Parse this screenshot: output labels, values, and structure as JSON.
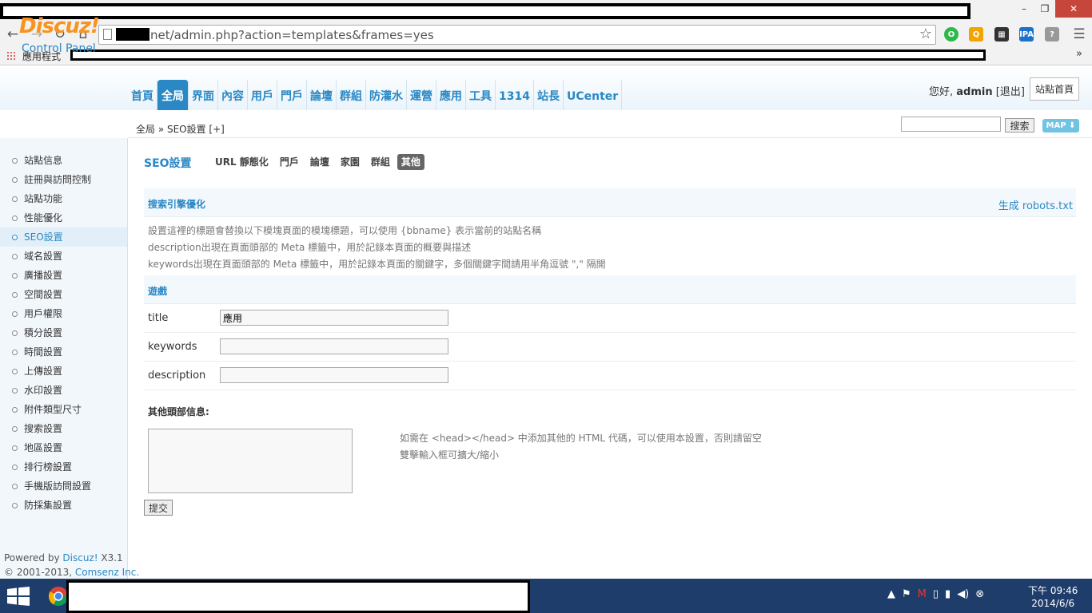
{
  "browser": {
    "url_visible": "net/admin.php?action=templates&frames=yes",
    "apps_label": "應用程式",
    "win_min": "–",
    "win_max": "❐",
    "win_close": "✕"
  },
  "header": {
    "logo": "Discuz!",
    "logo_sub": "Control Panel",
    "nav": [
      "首頁",
      "全局",
      "界面",
      "內容",
      "用戶",
      "門戶",
      "論壇",
      "群組",
      "防灌水",
      "運營",
      "應用",
      "工具",
      "1314",
      "站長",
      "UCenter"
    ],
    "active_nav": "全局",
    "greeting_prefix": "您好,",
    "user": "admin",
    "logout": "[退出]",
    "site_home": "站點首頁"
  },
  "subbar": {
    "breadcrumb": "全局 » SEO設置  [+]",
    "search_btn": "搜索",
    "map_btn": "MAP ⬇"
  },
  "sidebar": {
    "items": [
      "站點信息",
      "註冊與訪問控制",
      "站點功能",
      "性能優化",
      "SEO設置",
      "域名設置",
      "廣播設置",
      "空間設置",
      "用戶權限",
      "積分設置",
      "時間設置",
      "上傳設置",
      "水印設置",
      "附件類型尺寸",
      "搜索設置",
      "地區設置",
      "排行榜設置",
      "手機版訪問設置",
      "防採集設置"
    ],
    "active": "SEO設置",
    "powered_line1": "Powered by",
    "powered_brand": "Discuz!",
    "powered_ver": " X3.1",
    "copyright": "© 2001-2013, ",
    "company": "Comsenz Inc."
  },
  "content": {
    "title": "SEO設置",
    "tabs": [
      "URL 靜態化",
      "門戶",
      "論壇",
      "家園",
      "群組",
      "其他"
    ],
    "active_tab": "其他",
    "section1_title": "搜索引擎優化",
    "robots_link": "生成 robots.txt",
    "tips": [
      "設置這裡的標題會替換以下模塊頁面的模塊標題，可以使用 {bbname} 表示當前的站點名稱",
      "description出現在頁面頭部的 Meta 標籤中，用於記錄本頁面的概要與描述",
      "keywords出現在頁面頭部的 Meta 標籤中，用於記錄本頁面的關鍵字，多個關鍵字間請用半角逗號 \",\" 隔開"
    ],
    "section2_title": "遊戲",
    "fields": [
      {
        "label": "title",
        "value": "應用"
      },
      {
        "label": "keywords",
        "value": ""
      },
      {
        "label": "description",
        "value": ""
      }
    ],
    "extra_label": "其他頭部信息:",
    "extra_tips": [
      "如需在 <head></head> 中添加其他的 HTML 代碼，可以使用本設置，否則請留空",
      "雙擊輸入框可擴大/縮小"
    ],
    "submit": "提交"
  },
  "taskbar": {
    "clock_line1": "下午 09:46",
    "clock_line2": "2014/6/6"
  },
  "colors": {
    "accent": "#2a88c4",
    "logo": "#f7931e",
    "taskbar": "#1e3d6b"
  }
}
